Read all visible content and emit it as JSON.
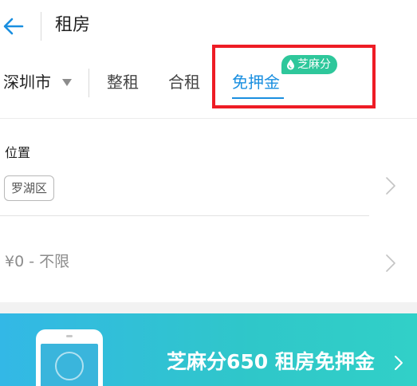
{
  "header": {
    "title": "租房"
  },
  "tabs": {
    "city": "深圳市",
    "items": [
      {
        "label": "整租"
      },
      {
        "label": "合租"
      },
      {
        "label": "免押金"
      }
    ],
    "badge": "芝麻分",
    "active_color": "#1a8fe0",
    "badge_color": "#2ec79b",
    "highlight_color": "#ee1c25"
  },
  "filters": {
    "location_label": "位置",
    "district": "罗湖区",
    "price_range": "¥0 - 不限"
  },
  "banner": {
    "text": "芝麻分650 租房免押金"
  }
}
